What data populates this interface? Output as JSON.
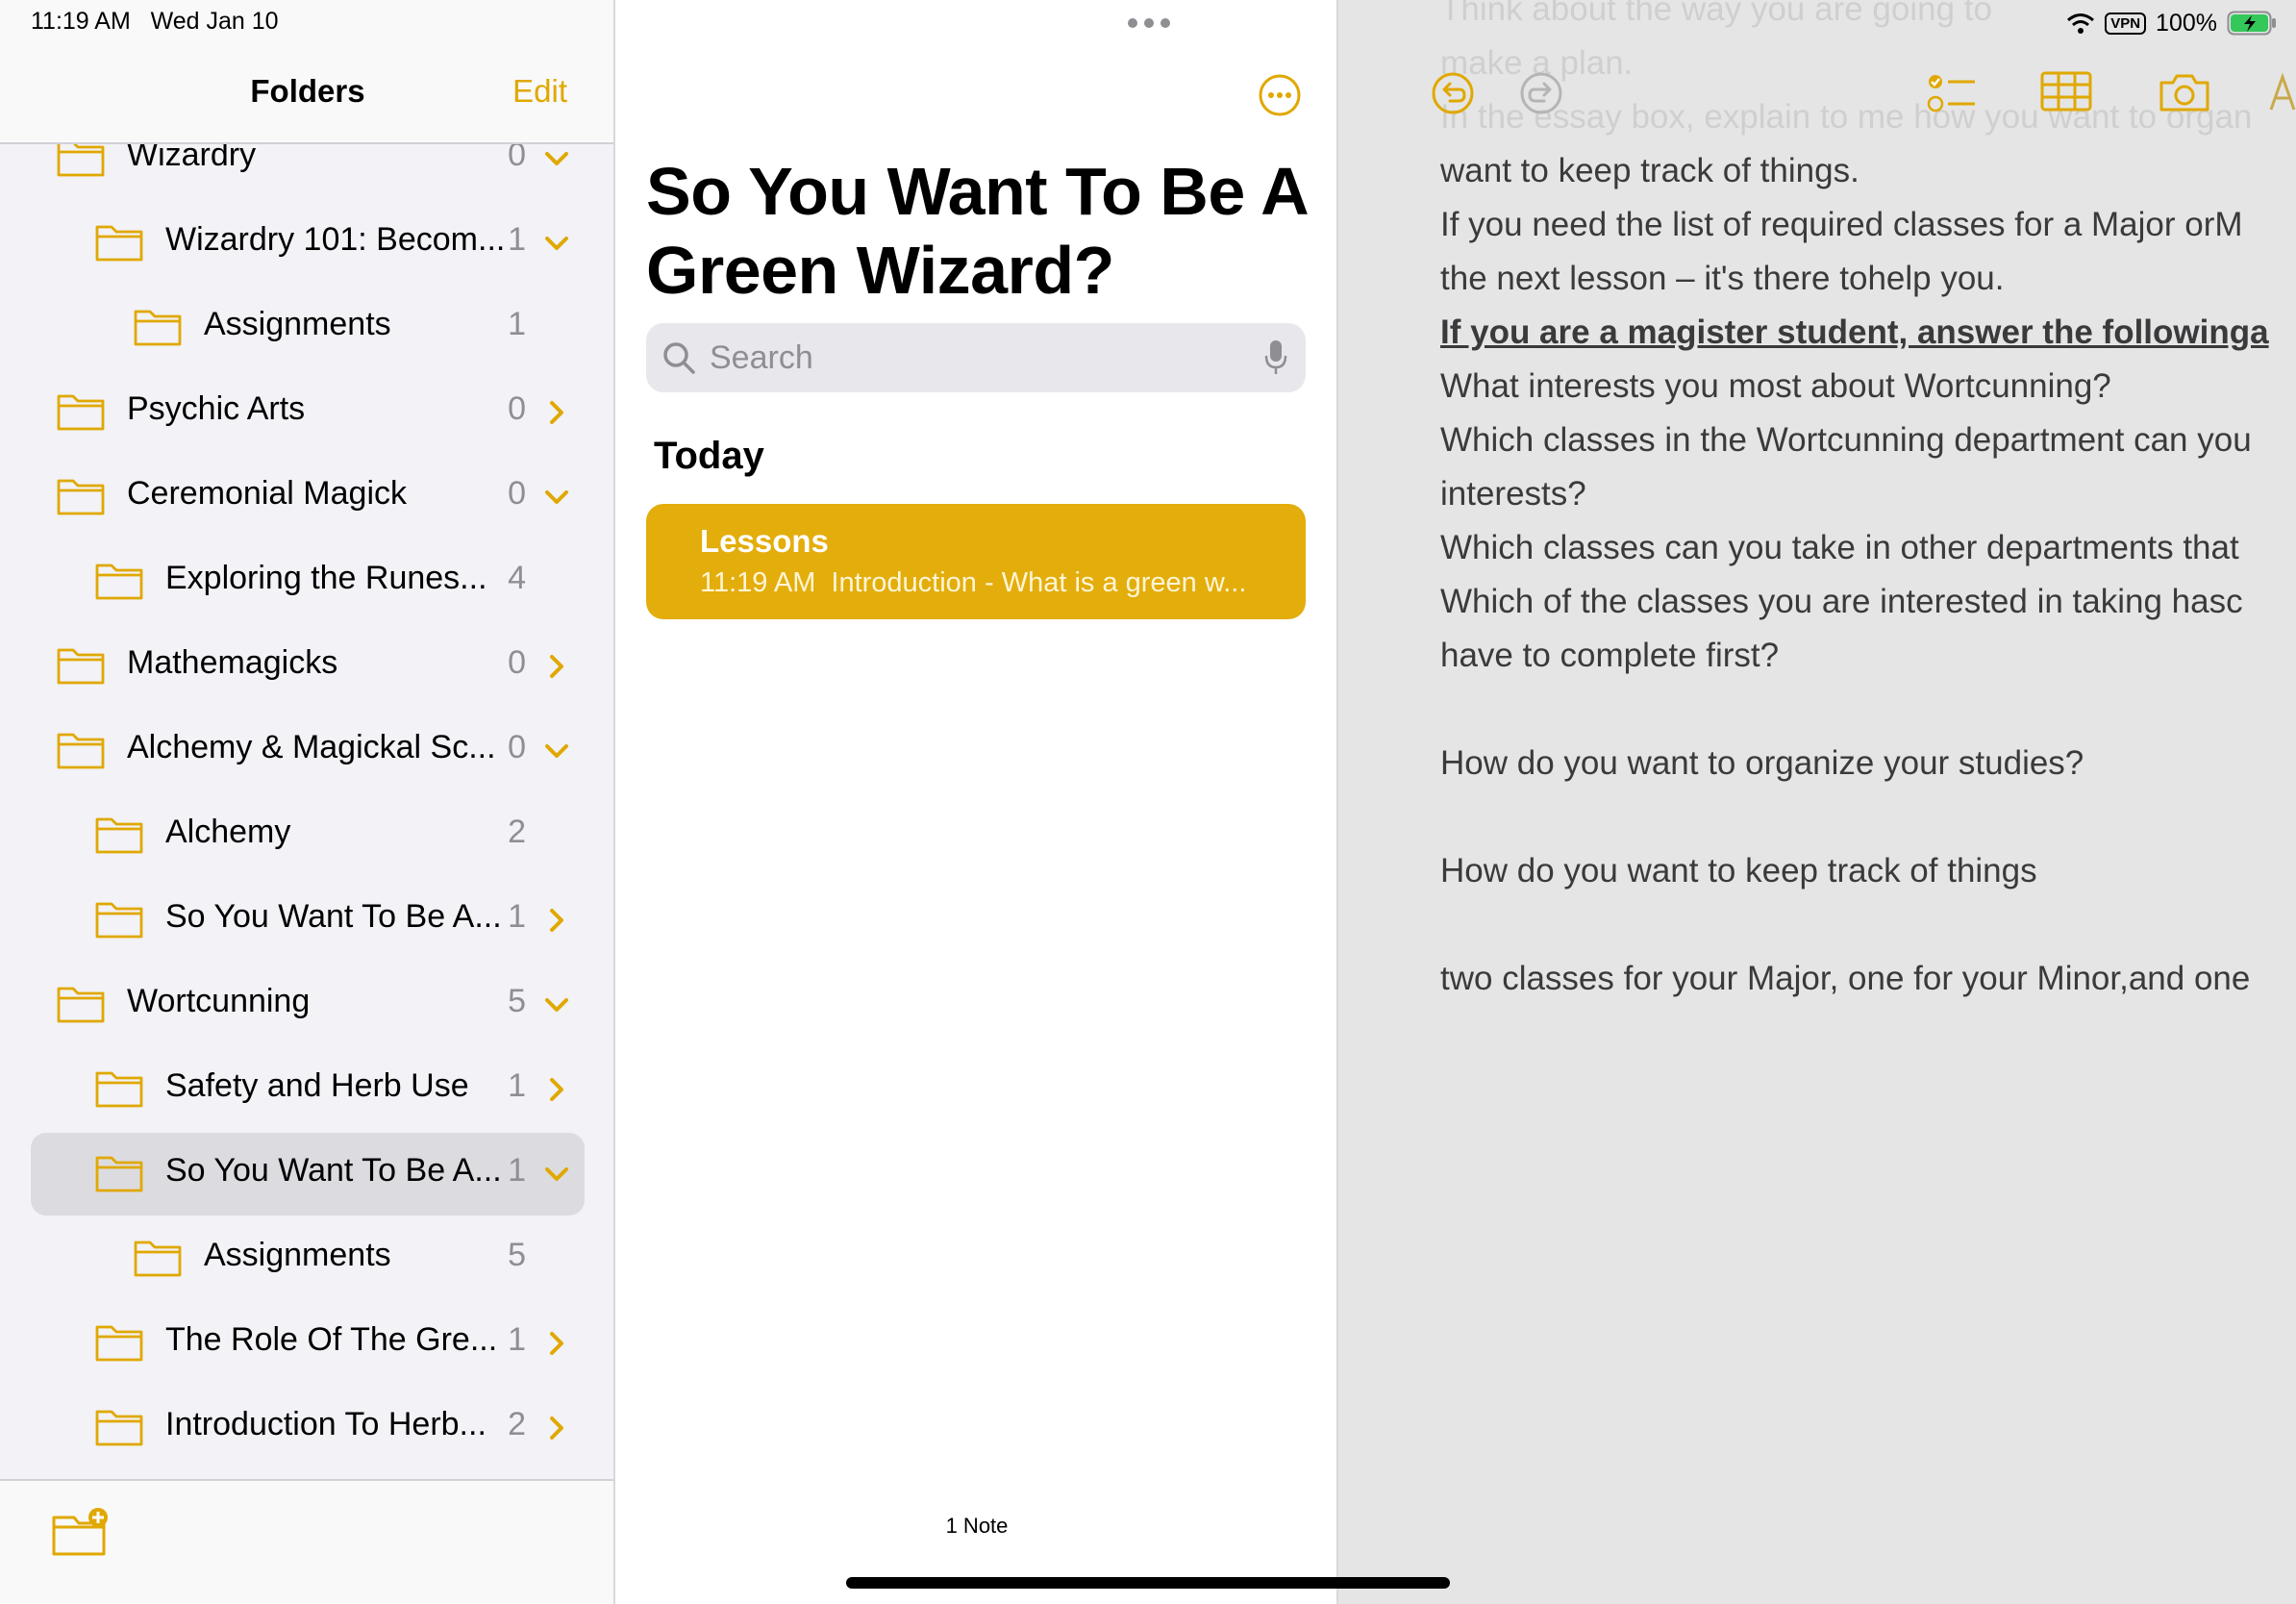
{
  "status_bar": {
    "time": "11:19 AM",
    "date": "Wed Jan 10",
    "vpn": "VPN",
    "battery": "100%"
  },
  "sidebar": {
    "title": "Folders",
    "edit_label": "Edit",
    "folders": [
      {
        "name": "Wizardry",
        "count": "0",
        "indent": 0,
        "chevron": "down"
      },
      {
        "name": "Wizardry 101: Becom...",
        "count": "1",
        "indent": 1,
        "chevron": "down"
      },
      {
        "name": "Assignments",
        "count": "1",
        "indent": 2,
        "chevron": "none"
      },
      {
        "name": "Psychic Arts",
        "count": "0",
        "indent": 0,
        "chevron": "right"
      },
      {
        "name": "Ceremonial Magick",
        "count": "0",
        "indent": 0,
        "chevron": "down"
      },
      {
        "name": "Exploring the Runes...",
        "count": "4",
        "indent": 1,
        "chevron": "none"
      },
      {
        "name": "Mathemagicks",
        "count": "0",
        "indent": 0,
        "chevron": "right"
      },
      {
        "name": "Alchemy & Magickal Sc...",
        "count": "0",
        "indent": 0,
        "chevron": "down"
      },
      {
        "name": "Alchemy",
        "count": "2",
        "indent": 1,
        "chevron": "none"
      },
      {
        "name": "So You Want To Be A...",
        "count": "1",
        "indent": 1,
        "chevron": "right"
      },
      {
        "name": "Wortcunning",
        "count": "5",
        "indent": 0,
        "chevron": "down"
      },
      {
        "name": "Safety and Herb Use",
        "count": "1",
        "indent": 1,
        "chevron": "right"
      },
      {
        "name": "So You Want To Be A...",
        "count": "1",
        "indent": 1,
        "chevron": "down",
        "selected": true
      },
      {
        "name": "Assignments",
        "count": "5",
        "indent": 2,
        "chevron": "none"
      },
      {
        "name": "The Role Of The Gre...",
        "count": "1",
        "indent": 1,
        "chevron": "right"
      },
      {
        "name": "Introduction To Herb...",
        "count": "2",
        "indent": 1,
        "chevron": "right"
      }
    ]
  },
  "notes_list": {
    "title": "So You Want To Be A Green Wizard?",
    "search_placeholder": "Search",
    "section_header": "Today",
    "notes": [
      {
        "title": "Lessons",
        "time": "11:19 AM",
        "preview": "Introduction - What is a green w..."
      }
    ],
    "count_label": "1 Note"
  },
  "editor": {
    "lines": [
      {
        "text": "Think about the way you are going to",
        "style": "faded"
      },
      {
        "text": "make a plan.",
        "style": "faded"
      },
      {
        "text": "In the essay box, explain to me how you want to organ",
        "style": "faded"
      },
      {
        "text": "want to keep track of things.",
        "style": "normal"
      },
      {
        "text": "If you need the list of required classes for a Major orM",
        "style": "normal"
      },
      {
        "text": "the next lesson – it's there tohelp you.",
        "style": "normal"
      },
      {
        "text": "If you are a magister student, answer the followinga",
        "style": "bold"
      },
      {
        "text": "What interests you most about Wortcunning?",
        "style": "normal"
      },
      {
        "text": "Which classes in the Wortcunning department can you",
        "style": "normal"
      },
      {
        "text": "interests?",
        "style": "normal"
      },
      {
        "text": "Which classes can you take in other departments that",
        "style": "normal"
      },
      {
        "text": "Which of the classes you are interested in taking hasc",
        "style": "normal"
      },
      {
        "text": "have to complete first?",
        "style": "normal"
      },
      {
        "text": "",
        "style": "normal"
      },
      {
        "text": "How do you want to organize your studies?",
        "style": "normal"
      },
      {
        "text": "",
        "style": "normal"
      },
      {
        "text": "How do you want to keep track of things",
        "style": "normal"
      },
      {
        "text": "",
        "style": "normal"
      },
      {
        "text": "two classes for your Major, one for your Minor,and one",
        "style": "normal"
      }
    ]
  },
  "colors": {
    "accent": "#e0a800",
    "note_card": "#e3ad0b",
    "sidebar_bg": "#f2f2f7",
    "editor_bg": "#e5e5e5",
    "selected_row": "#dcdce0"
  },
  "icons": {
    "folder": "folder-icon",
    "chevron_down": "chevron-down-icon",
    "chevron_right": "chevron-right-icon",
    "new_folder": "new-folder-icon",
    "search": "search-icon",
    "mic": "mic-icon",
    "more": "more-icon",
    "undo": "undo-icon",
    "redo": "redo-icon",
    "checklist": "checklist-icon",
    "table": "table-icon",
    "camera": "camera-icon"
  }
}
